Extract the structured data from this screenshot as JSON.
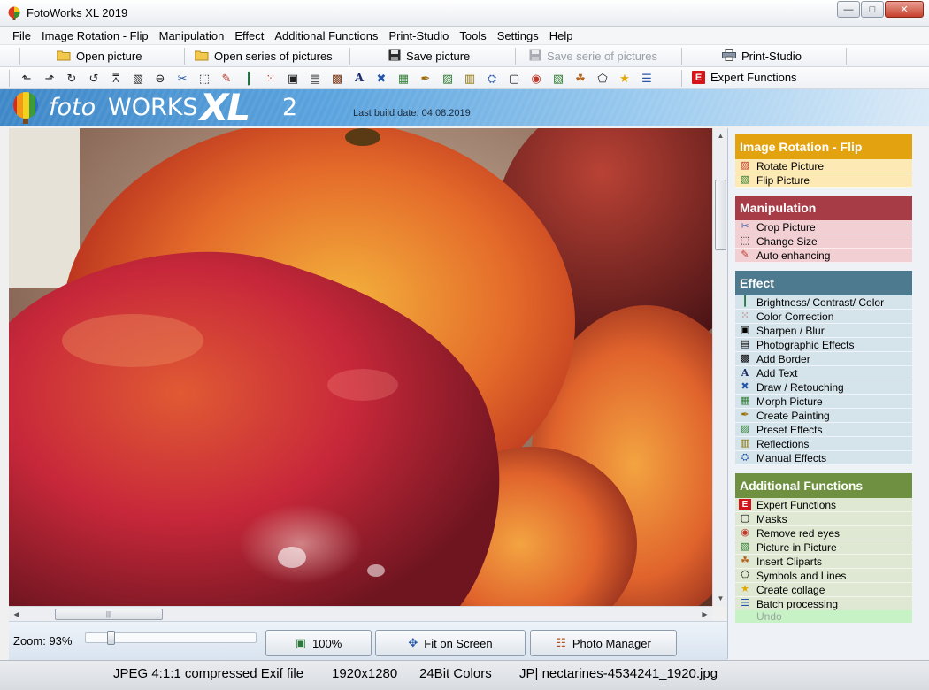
{
  "window": {
    "title": "FotoWorks XL 2019"
  },
  "menu": [
    "File",
    "Image Rotation - Flip",
    "Manipulation",
    "Effect",
    "Additional Functions",
    "Print-Studio",
    "Tools",
    "Settings",
    "Help"
  ],
  "toolbar": {
    "open_picture": "Open picture",
    "open_series": "Open series of pictures",
    "save_picture": "Save picture",
    "save_series": "Save serie of pictures",
    "print_studio": "Print-Studio",
    "expert_functions": "Expert Functions"
  },
  "icon_toolbar": [
    "rotate-left-icon",
    "rotate-right-icon",
    "rotate-ccw-icon",
    "rotate-cw-icon",
    "flip-vertical-icon",
    "flip-horizontal-icon",
    "flip-3d-icon",
    "crop-icon",
    "resize-icon",
    "auto-enhance-icon",
    "brightness-icon",
    "color-correction-icon",
    "sharpen-icon",
    "photo-effects-icon",
    "border-icon",
    "text-icon",
    "draw-icon",
    "morph-icon",
    "painting-icon",
    "preset-effects-icon",
    "reflections-icon",
    "manual-effects-icon",
    "mask-icon",
    "red-eye-icon",
    "picture-in-picture-icon",
    "cliparts-icon",
    "symbols-icon",
    "collage-icon",
    "batch-icon"
  ],
  "banner": {
    "logo_foto": "foto",
    "logo_works": "WORKS",
    "logo_xl": "XL",
    "logo_version": "2",
    "build_date": "Last build date: 04.08.2019"
  },
  "zoom": {
    "label": "Zoom: 93%",
    "level_percent": 93
  },
  "buttons": {
    "hundred_percent": "100%",
    "fit_on_screen": "Fit on Screen",
    "photo_manager": "Photo Manager"
  },
  "panel": {
    "sections": [
      {
        "title": "Image Rotation - Flip",
        "header_color": "#e3a20f",
        "item_bg": "#fde9b4",
        "items": [
          {
            "label": "Rotate Picture",
            "icon": "rotate-picture-icon"
          },
          {
            "label": "Flip Picture",
            "icon": "flip-picture-icon"
          }
        ]
      },
      {
        "title": "Manipulation",
        "header_color": "#a83c46",
        "item_bg": "#f1cfd3",
        "items": [
          {
            "label": "Crop Picture",
            "icon": "scissors-icon"
          },
          {
            "label": "Change Size",
            "icon": "resize-icon"
          },
          {
            "label": "Auto enhancing",
            "icon": "magic-wand-icon"
          }
        ]
      },
      {
        "title": "Effect",
        "header_color": "#4d7a8e",
        "item_bg": "#d5e3ea",
        "items": [
          {
            "label": "Brightness/ Contrast/ Color",
            "icon": "levels-icon"
          },
          {
            "label": "Color Correction",
            "icon": "color-dots-icon"
          },
          {
            "label": "Sharpen / Blur",
            "icon": "sharpen-icon"
          },
          {
            "label": "Photographic Effects",
            "icon": "camera-icon"
          },
          {
            "label": "Add Border",
            "icon": "frame-icon"
          },
          {
            "label": "Add Text",
            "icon": "text-a-icon"
          },
          {
            "label": "Draw / Retouching",
            "icon": "brush-icon"
          },
          {
            "label": "Morph Picture",
            "icon": "morph-icon"
          },
          {
            "label": "Create Painting",
            "icon": "pen-icon"
          },
          {
            "label": "Preset Effects",
            "icon": "preset-icon"
          },
          {
            "label": "Reflections",
            "icon": "reflection-icon"
          },
          {
            "label": "Manual Effects",
            "icon": "manual-effects-icon"
          }
        ]
      },
      {
        "title": "Additional Functions",
        "header_color": "#6e9040",
        "item_bg": "#dfe8d2",
        "items": [
          {
            "label": "Expert Functions",
            "icon": "expert-e-icon"
          },
          {
            "label": "Masks",
            "icon": "mask-icon"
          },
          {
            "label": "Remove red eyes",
            "icon": "red-eye-icon"
          },
          {
            "label": "Picture in Picture",
            "icon": "picture-in-picture-icon"
          },
          {
            "label": "Insert Cliparts",
            "icon": "clipart-icon"
          },
          {
            "label": "Symbols and Lines",
            "icon": "symbols-icon"
          },
          {
            "label": "Create collage",
            "icon": "star-icon"
          },
          {
            "label": "Batch processing",
            "icon": "batch-icon"
          }
        ]
      }
    ],
    "undo": "Undo"
  },
  "status": {
    "format": "JPEG 4:1:1 compressed Exif file",
    "dimensions": "1920x1280",
    "colors": "24Bit Colors",
    "filename": "JP| nectarines-4534241_1920.jpg"
  }
}
